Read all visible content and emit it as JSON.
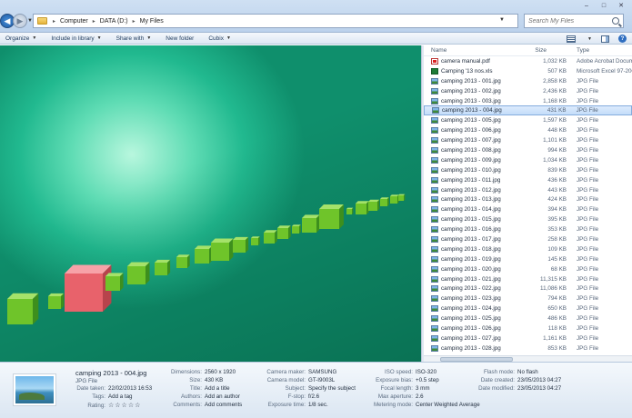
{
  "window": {
    "minimize": "–",
    "maximize": "□",
    "close": "✕"
  },
  "address": {
    "crumbs": [
      "Computer",
      "DATA (D:)",
      "My Files"
    ],
    "search_placeholder": "Search My Files"
  },
  "toolbar": {
    "organize": "Organize",
    "include": "Include in library",
    "share": "Share with",
    "new_folder": "New folder",
    "cubix": "Cubix"
  },
  "filelist": {
    "headers": {
      "name": "Name",
      "size": "Size",
      "type": "Type"
    },
    "rows": [
      {
        "icon": "pdf",
        "name": "camera manual.pdf",
        "size": "1,032 KB",
        "type": "Adobe Acrobat Docum"
      },
      {
        "icon": "xls",
        "name": "Camping '13 nos.xls",
        "size": "507 KB",
        "type": "Microsoft Excel 97-200"
      },
      {
        "icon": "jpg",
        "name": "camping 2013 - 001.jpg",
        "size": "2,858 KB",
        "type": "JPG File"
      },
      {
        "icon": "jpg",
        "name": "camping 2013 - 002.jpg",
        "size": "2,436 KB",
        "type": "JPG File"
      },
      {
        "icon": "jpg",
        "name": "camping 2013 - 003.jpg",
        "size": "1,168 KB",
        "type": "JPG File"
      },
      {
        "icon": "jpg",
        "name": "camping 2013 - 004.jpg",
        "size": "431 KB",
        "type": "JPG File",
        "selected": true
      },
      {
        "icon": "jpg",
        "name": "camping 2013 - 005.jpg",
        "size": "1,597 KB",
        "type": "JPG File"
      },
      {
        "icon": "jpg",
        "name": "camping 2013 - 006.jpg",
        "size": "448 KB",
        "type": "JPG File"
      },
      {
        "icon": "jpg",
        "name": "camping 2013 - 007.jpg",
        "size": "1,101 KB",
        "type": "JPG File"
      },
      {
        "icon": "jpg",
        "name": "camping 2013 - 008.jpg",
        "size": "994 KB",
        "type": "JPG File"
      },
      {
        "icon": "jpg",
        "name": "camping 2013 - 009.jpg",
        "size": "1,034 KB",
        "type": "JPG File"
      },
      {
        "icon": "jpg",
        "name": "camping 2013 - 010.jpg",
        "size": "839 KB",
        "type": "JPG File"
      },
      {
        "icon": "jpg",
        "name": "camping 2013 - 011.jpg",
        "size": "436 KB",
        "type": "JPG File"
      },
      {
        "icon": "jpg",
        "name": "camping 2013 - 012.jpg",
        "size": "443 KB",
        "type": "JPG File"
      },
      {
        "icon": "jpg",
        "name": "camping 2013 - 013.jpg",
        "size": "424 KB",
        "type": "JPG File"
      },
      {
        "icon": "jpg",
        "name": "camping 2013 - 014.jpg",
        "size": "394 KB",
        "type": "JPG File"
      },
      {
        "icon": "jpg",
        "name": "camping 2013 - 015.jpg",
        "size": "395 KB",
        "type": "JPG File"
      },
      {
        "icon": "jpg",
        "name": "camping 2013 - 016.jpg",
        "size": "353 KB",
        "type": "JPG File"
      },
      {
        "icon": "jpg",
        "name": "camping 2013 - 017.jpg",
        "size": "258 KB",
        "type": "JPG File"
      },
      {
        "icon": "jpg",
        "name": "camping 2013 - 018.jpg",
        "size": "109 KB",
        "type": "JPG File"
      },
      {
        "icon": "jpg",
        "name": "camping 2013 - 019.jpg",
        "size": "145 KB",
        "type": "JPG File"
      },
      {
        "icon": "jpg",
        "name": "camping 2013 - 020.jpg",
        "size": "68 KB",
        "type": "JPG File"
      },
      {
        "icon": "jpg",
        "name": "camping 2013 - 021.jpg",
        "size": "11,315 KB",
        "type": "JPG File"
      },
      {
        "icon": "jpg",
        "name": "camping 2013 - 022.jpg",
        "size": "11,086 KB",
        "type": "JPG File"
      },
      {
        "icon": "jpg",
        "name": "camping 2013 - 023.jpg",
        "size": "794 KB",
        "type": "JPG File"
      },
      {
        "icon": "jpg",
        "name": "camping 2013 - 024.jpg",
        "size": "650 KB",
        "type": "JPG File"
      },
      {
        "icon": "jpg",
        "name": "camping 2013 - 025.jpg",
        "size": "486 KB",
        "type": "JPG File"
      },
      {
        "icon": "jpg",
        "name": "camping 2013 - 026.jpg",
        "size": "118 KB",
        "type": "JPG File"
      },
      {
        "icon": "jpg",
        "name": "camping 2013 - 027.jpg",
        "size": "1,161 KB",
        "type": "JPG File"
      },
      {
        "icon": "jpg",
        "name": "camping 2013 - 028.jpg",
        "size": "853 KB",
        "type": "JPG File"
      }
    ]
  },
  "details": {
    "title": "camping 2013 - 004.jpg",
    "file_type": "JPG File",
    "props": [
      {
        "k": "Date taken:",
        "v": "22/02/2013 16:53"
      },
      {
        "k": "Tags:",
        "v": "Add a tag"
      },
      {
        "k": "Rating:",
        "v": "☆☆☆☆☆"
      },
      {
        "k": "Dimensions:",
        "v": "2560 x 1920"
      },
      {
        "k": "Size:",
        "v": "430 KB"
      },
      {
        "k": "Title:",
        "v": "Add a title"
      },
      {
        "k": "Authors:",
        "v": "Add an author"
      },
      {
        "k": "Comments:",
        "v": "Add comments"
      },
      {
        "k": "Camera maker:",
        "v": "SAMSUNG"
      },
      {
        "k": "Camera model:",
        "v": "GT-I9003L"
      },
      {
        "k": "Subject:",
        "v": "Specify the subject"
      },
      {
        "k": "F-stop:",
        "v": "f/2.6"
      },
      {
        "k": "Exposure time:",
        "v": "1/8 sec."
      },
      {
        "k": "ISO speed:",
        "v": "ISO-320"
      },
      {
        "k": "Exposure bias:",
        "v": "+0.5 step"
      },
      {
        "k": "Focal length:",
        "v": "3 mm"
      },
      {
        "k": "Max aperture:",
        "v": "2.6"
      },
      {
        "k": "Metering mode:",
        "v": "Center Weighted Average"
      },
      {
        "k": "Flash mode:",
        "v": "No flash"
      },
      {
        "k": "Date created:",
        "v": "23/05/2013 04:27"
      },
      {
        "k": "Date modified:",
        "v": "23/05/2013 04:27"
      }
    ]
  },
  "colors": {
    "cube_green": "#6fc42a",
    "cube_red": "#e8626b",
    "selection": "#c4ddfa"
  }
}
